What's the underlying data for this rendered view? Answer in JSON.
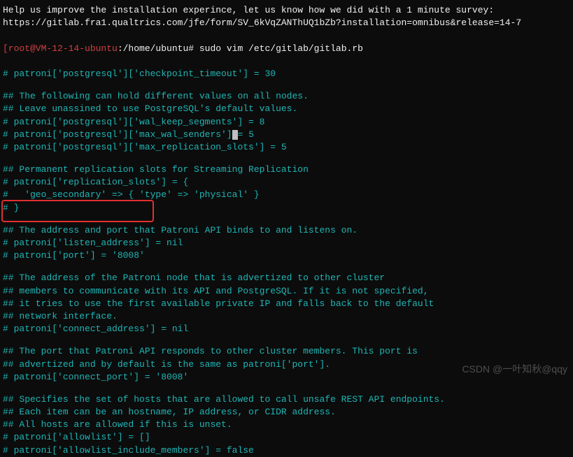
{
  "header": {
    "survey_line1": "Help us improve the installation experince, let us know how we did with a 1 minute survey:",
    "survey_line2": "https://gitlab.fra1.qualtrics.com/jfe/form/SV_6kVqZANThUQ1bZb?installation=omnibus&release=14-7"
  },
  "prompt": {
    "user_host": "[root@VM-12-14-ubuntu",
    "path": ":/home/ubuntu# ",
    "command": "sudo vim /etc/gitlab/gitlab.rb"
  },
  "config": {
    "l01": "# patroni['postgresql']['checkpoint_timeout'] = 30",
    "l02": "",
    "l03": "## The following can hold different values on all nodes.",
    "l04": "## Leave unassined to use PostgreSQL's default values.",
    "l05": "# patroni['postgresql']['wal_keep_segments'] = 8",
    "l06a": "# patroni['postgresql']['max_wal_senders']",
    "l06b": "= 5",
    "l07": "# patroni['postgresql']['max_replication_slots'] = 5",
    "l08": "",
    "l09": "## Permanent replication slots for Streaming Replication",
    "l10": "# patroni['replication_slots'] = {",
    "l11": "#   'geo_secondary' => { 'type' => 'physical' }",
    "l12": "# }",
    "l13": "",
    "l14": "## The address and port that Patroni API binds to and listens on.",
    "l15": "# patroni['listen_address'] = nil",
    "l16": "# patroni['port'] = '8008'",
    "l17": "",
    "l18": "## The address of the Patroni node that is advertized to other cluster",
    "l19": "## members to communicate with its API and PostgreSQL. If it is not specified,",
    "l20": "## it tries to use the first available private IP and falls back to the default",
    "l21": "## network interface.",
    "l22": "# patroni['connect_address'] = nil",
    "l23": "",
    "l24": "## The port that Patroni API responds to other cluster members. This port is",
    "l25": "## advertized and by default is the same as patroni['port'].",
    "l26": "# patroni['connect_port'] = '8008'",
    "l27": "",
    "l28": "## Specifies the set of hosts that are allowed to call unsafe REST API endpoints.",
    "l29": "## Each item can be an hostname, IP address, or CIDR address.",
    "l30": "## All hosts are allowed if this is unset.",
    "l31": "# patroni['allowlist'] = []",
    "l32": "# patroni['allowlist_include_members'] = false"
  },
  "watermark": "CSDN @一叶知秋@qqy"
}
